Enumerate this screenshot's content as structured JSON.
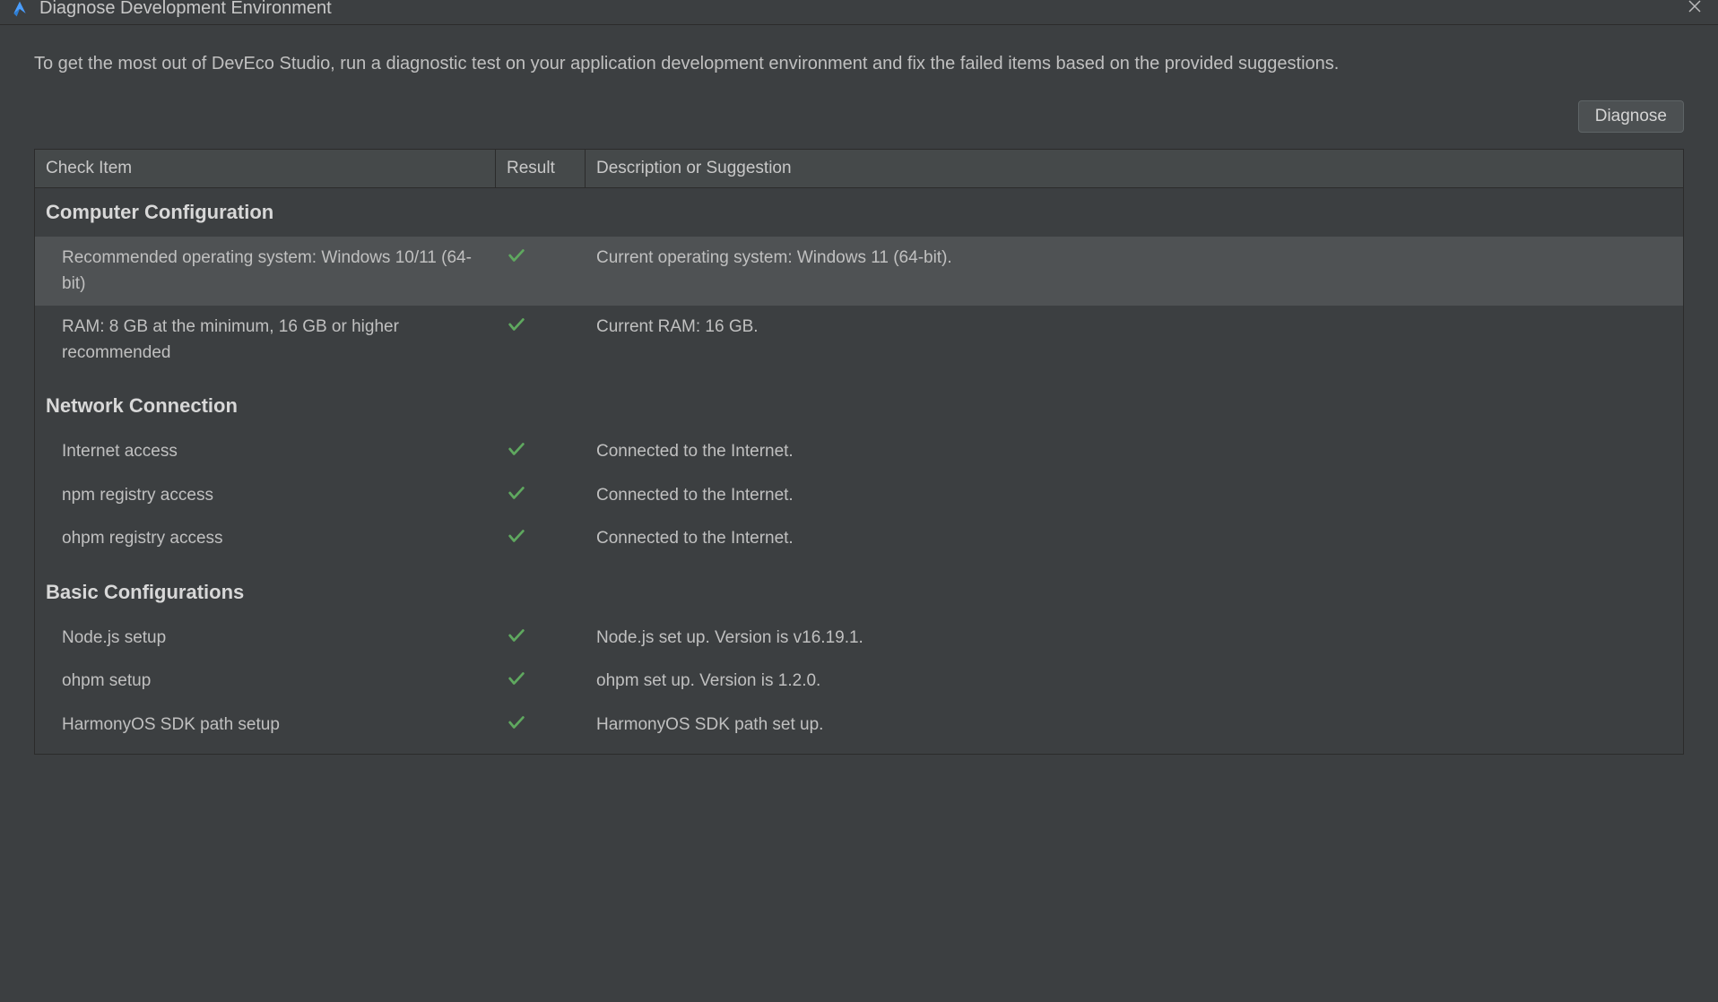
{
  "window": {
    "title": "Diagnose Development Environment"
  },
  "description": "To get the most out of DevEco Studio, run a diagnostic test on your application development environment and fix the failed items based on the provided suggestions.",
  "buttons": {
    "diagnose": "Diagnose"
  },
  "table": {
    "headers": {
      "check": "Check Item",
      "result": "Result",
      "description": "Description or Suggestion"
    }
  },
  "sections": [
    {
      "title": "Computer Configuration",
      "rows": [
        {
          "check": "Recommended operating system: Windows 10/11 (64-bit)",
          "result": "pass",
          "description": "Current operating system: Windows 11 (64-bit).",
          "highlighted": true
        },
        {
          "check": "RAM: 8 GB at the minimum, 16 GB or higher recommended",
          "result": "pass",
          "description": "Current RAM: 16 GB."
        }
      ]
    },
    {
      "title": "Network Connection",
      "rows": [
        {
          "check": "Internet access",
          "result": "pass",
          "description": "Connected to the Internet."
        },
        {
          "check": "npm registry access",
          "result": "pass",
          "description": "Connected to the Internet."
        },
        {
          "check": "ohpm registry access",
          "result": "pass",
          "description": "Connected to the Internet."
        }
      ]
    },
    {
      "title": "Basic Configurations",
      "rows": [
        {
          "check": "Node.js setup",
          "result": "pass",
          "description": "Node.js set up. Version is v16.19.1."
        },
        {
          "check": "ohpm setup",
          "result": "pass",
          "description": "ohpm set up. Version is 1.2.0."
        },
        {
          "check": "HarmonyOS SDK path setup",
          "result": "pass",
          "description": "HarmonyOS SDK path set up."
        }
      ]
    }
  ]
}
